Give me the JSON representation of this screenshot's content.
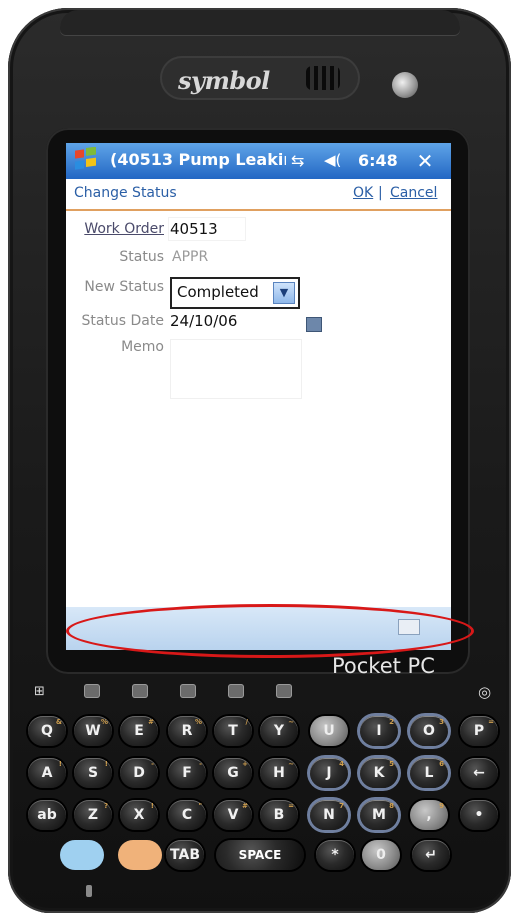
{
  "device": {
    "logo": "symbol",
    "brand": "Pocket PC",
    "highlight_color": "#d81818",
    "status_bar_color": "#2367c4"
  },
  "titlebar": {
    "title": "(40513 Pump Leakir",
    "time": "6:48",
    "close_label": "✕",
    "start_icon": "windows-start-icon",
    "connectivity_icon": "connectivity-icon",
    "volume_icon": "speaker-icon"
  },
  "commandbar": {
    "heading": "Change Status",
    "ok_label": "OK",
    "separator": "|",
    "cancel_label": "Cancel"
  },
  "form": {
    "work_order_label": "Work Order",
    "work_order_value": "40513",
    "status_label": "Status",
    "status_value": "APPR",
    "new_status_label": "New Status",
    "new_status_value": "Completed",
    "status_date_label": "Status Date",
    "status_date_value": "24/10/06",
    "memo_label": "Memo",
    "memo_value": ""
  },
  "keypad": {
    "rows": [
      [
        {
          "k": "Q",
          "s": "&"
        },
        {
          "k": "W",
          "s": "%"
        },
        {
          "k": "E",
          "s": "#"
        },
        {
          "k": "R",
          "s": "%"
        },
        {
          "k": "T",
          "s": "/"
        },
        {
          "k": "Y",
          "s": "~"
        },
        {
          "k": "U",
          "s": ""
        },
        {
          "k": "I",
          "s": "2"
        },
        {
          "k": "O",
          "s": "3"
        },
        {
          "k": "P",
          "s": "="
        }
      ],
      [
        {
          "k": "A",
          "s": "!"
        },
        {
          "k": "S",
          "s": "!"
        },
        {
          "k": "D",
          "s": "-"
        },
        {
          "k": "F",
          "s": "-"
        },
        {
          "k": "G",
          "s": "+"
        },
        {
          "k": "H",
          "s": "~"
        },
        {
          "k": "J",
          "s": "4"
        },
        {
          "k": "K",
          "s": "5"
        },
        {
          "k": "L",
          "s": "6"
        },
        {
          "k": "←",
          "s": ""
        }
      ],
      [
        {
          "k": "ab",
          "s": ""
        },
        {
          "k": "Z",
          "s": "?"
        },
        {
          "k": "X",
          "s": "!"
        },
        {
          "k": "C",
          "s": "\""
        },
        {
          "k": "V",
          "s": "#"
        },
        {
          "k": "B",
          "s": "="
        },
        {
          "k": "N",
          "s": "7"
        },
        {
          "k": "M",
          "s": "8"
        },
        {
          "k": ",",
          "s": "9"
        },
        {
          "k": "•",
          "s": ""
        }
      ]
    ],
    "space_label": "SPACE",
    "tab_label": "TAB",
    "zero_label": "0",
    "star_label": "*",
    "enter_label": "↵",
    "blue_button_color": "#9fd0f0",
    "orange_button_color": "#f0b27a"
  }
}
